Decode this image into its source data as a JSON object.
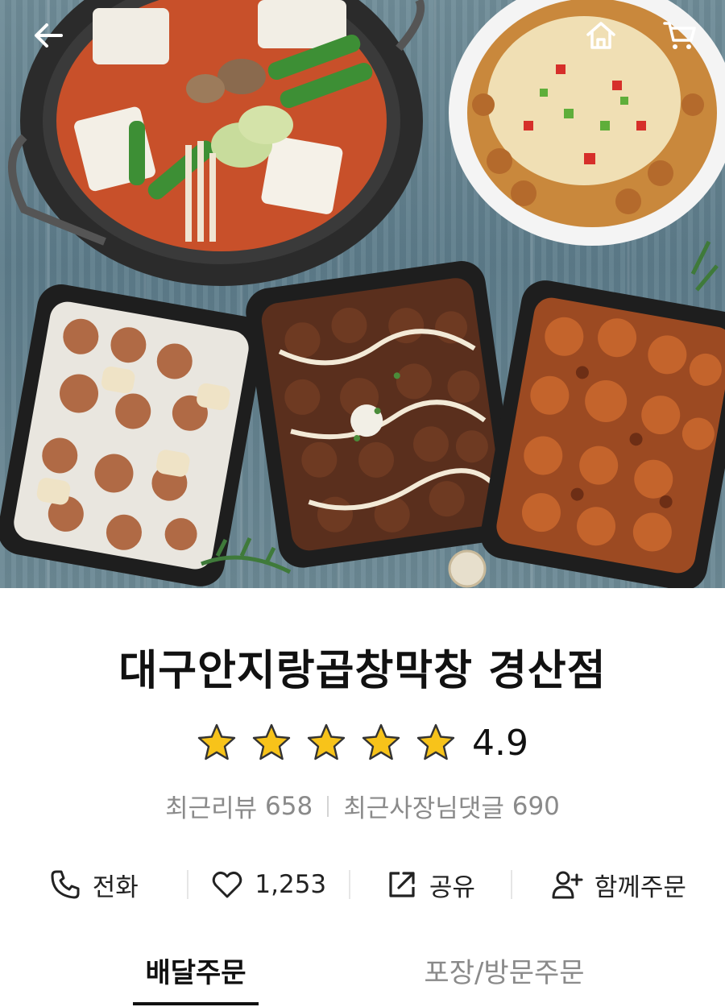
{
  "header": {
    "back_icon": "arrow-left-icon",
    "home_icon": "home-icon",
    "cart_icon": "cart-icon",
    "icon_color": "#ffffff"
  },
  "store": {
    "name": "대구안지랑곱창막창 경산점",
    "rating": "4.9",
    "rating_stars": 5,
    "star_color": "#f7c31a",
    "recent_reviews_label": "최근리뷰",
    "recent_reviews_count": "658",
    "owner_replies_label": "최근사장님댓글",
    "owner_replies_count": "690"
  },
  "actions": {
    "call": {
      "icon": "phone-icon",
      "label": "전화"
    },
    "like": {
      "icon": "heart-icon",
      "label": "1,253"
    },
    "share": {
      "icon": "share-icon",
      "label": "공유"
    },
    "group_order": {
      "icon": "add-user-icon",
      "label": "함께주문"
    }
  },
  "tabs": {
    "delivery": "배달주문",
    "pickup": "포장/방문주문",
    "active": "delivery"
  }
}
